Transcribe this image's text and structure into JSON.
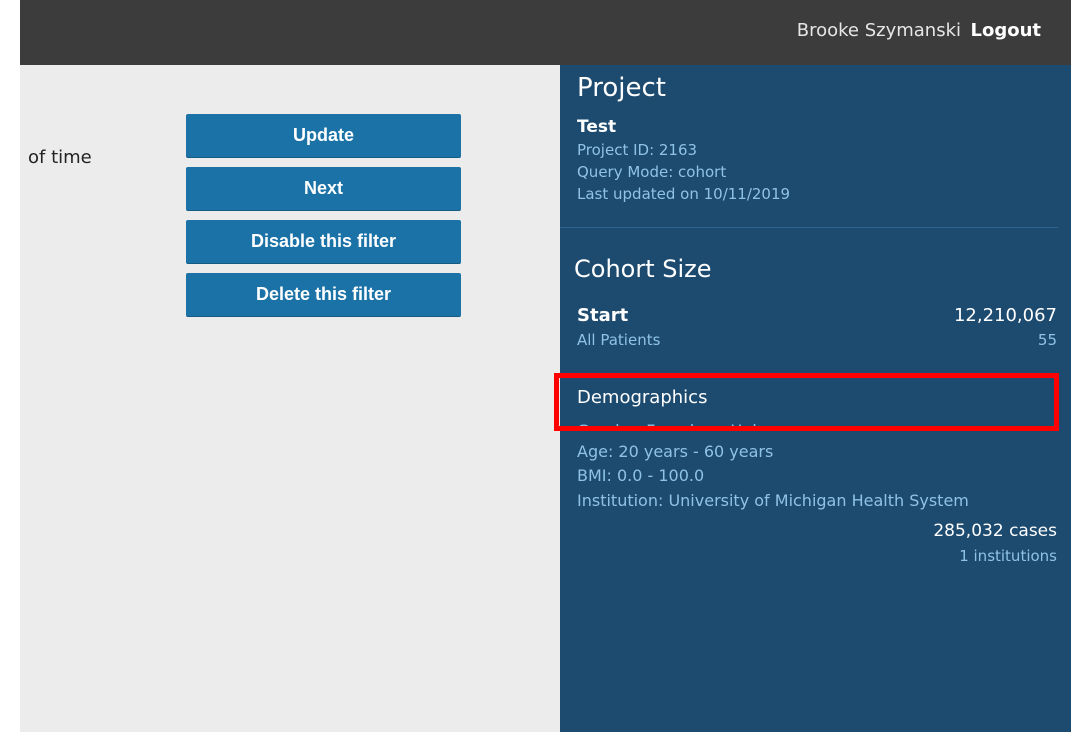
{
  "header": {
    "user_name": "Brooke Szymanski",
    "logout_label": "Logout"
  },
  "main": {
    "fragment_text": "of time",
    "buttons": {
      "update": "Update",
      "next": "Next",
      "disable": "Disable this filter",
      "delete": "Delete this filter"
    }
  },
  "sidebar": {
    "project_heading": "Project",
    "project_name": "Test",
    "project_id": "Project ID: 2163",
    "query_mode": "Query Mode: cohort",
    "last_updated": "Last updated on 10/11/2019",
    "cohort_heading": "Cohort Size",
    "start": {
      "label": "Start",
      "value": "12,210,067",
      "sub_label": "All Patients",
      "sub_value": "55"
    },
    "demographics": {
      "label": "Demographics",
      "gender": "Gender: Female or Unknown",
      "age": "Age: 20 years - 60 years",
      "bmi": "BMI: 0.0 - 100.0",
      "institution": "Institution: University of Michigan Health System",
      "cases": "285,032 cases",
      "institutions": "1 institutions"
    }
  },
  "colors": {
    "topbar": "#3c3c3c",
    "main_bg": "#ececec",
    "button": "#1a72a7",
    "sidebar": "#1d4a6f",
    "sidebar_muted": "#8fc3e6",
    "highlight": "#ff0000"
  }
}
